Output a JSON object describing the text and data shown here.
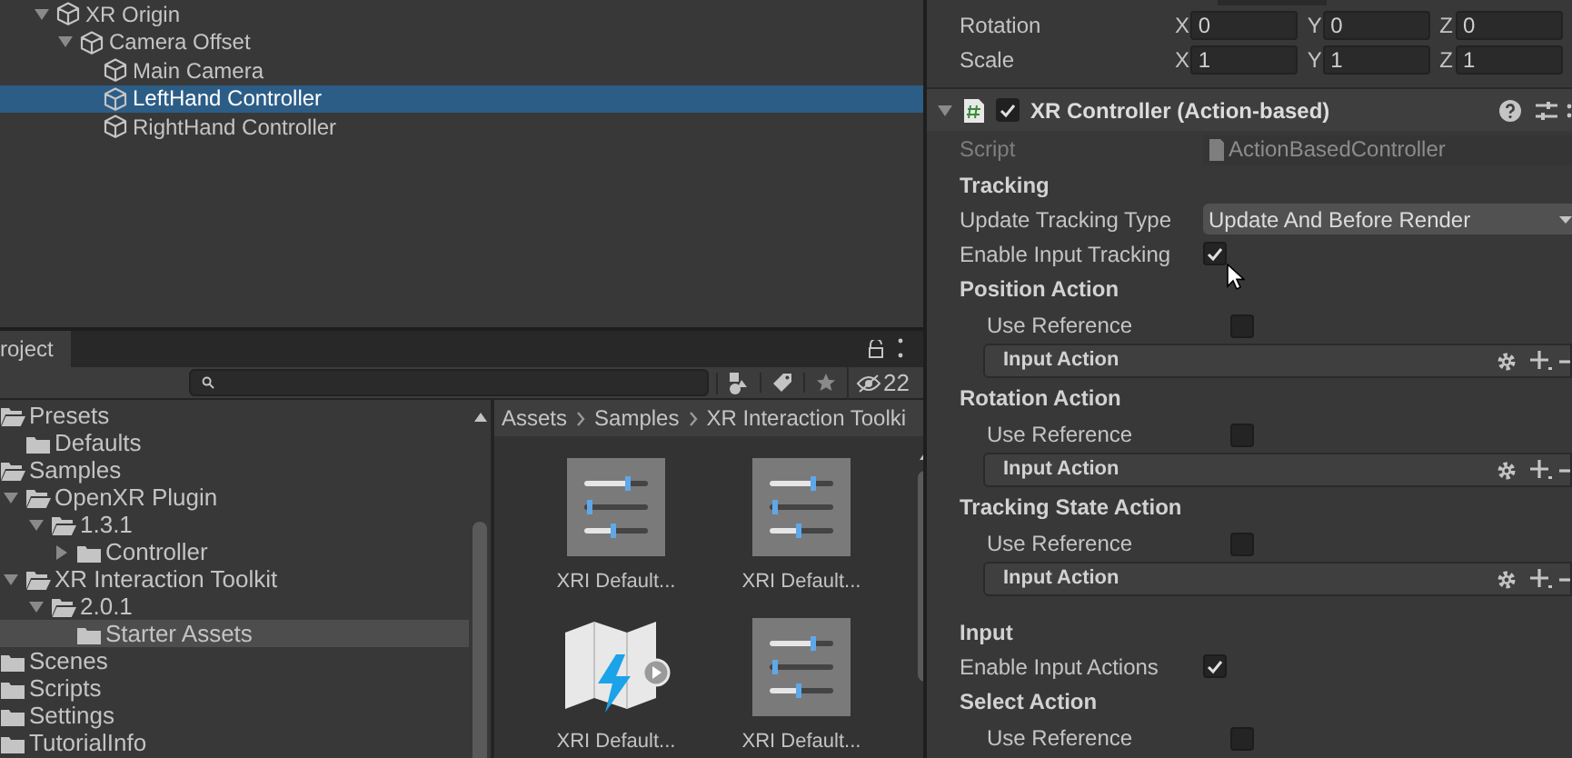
{
  "hierarchy": {
    "items": [
      {
        "label": "XR Origin",
        "expanded": true,
        "selected": false,
        "children": [
          {
            "label": "Camera Offset",
            "expanded": true,
            "selected": false,
            "children": [
              {
                "label": "Main Camera",
                "selected": false
              },
              {
                "label": "LeftHand Controller",
                "selected": true
              },
              {
                "label": "RightHand Controller",
                "selected": false
              }
            ]
          }
        ]
      }
    ]
  },
  "project": {
    "tab": "roject",
    "hidden_count": "22",
    "folders": [
      {
        "label": "Presets",
        "selected": false,
        "children": [
          {
            "label": "Defaults",
            "selected": false
          }
        ]
      },
      {
        "label": "Samples",
        "selected": false,
        "children": [
          {
            "label": "OpenXR Plugin",
            "expanded": true,
            "selected": false,
            "children": [
              {
                "label": "1.3.1",
                "expanded": true,
                "selected": false,
                "children": [
                  {
                    "label": "Controller",
                    "expanded": false,
                    "selected": false
                  }
                ]
              }
            ]
          },
          {
            "label": "XR Interaction Toolkit",
            "expanded": true,
            "selected": false,
            "children": [
              {
                "label": "2.0.1",
                "expanded": true,
                "selected": false,
                "children": [
                  {
                    "label": "Starter Assets",
                    "selected": true
                  }
                ]
              }
            ]
          }
        ]
      },
      {
        "label": "Scenes",
        "selected": false
      },
      {
        "label": "Scripts",
        "selected": false
      },
      {
        "label": "Settings",
        "selected": false
      },
      {
        "label": "TutorialInfo",
        "selected": false
      }
    ],
    "breadcrumb": [
      "Assets",
      "Samples",
      "XR Interaction Toolki"
    ],
    "assets": [
      {
        "kind": "preset",
        "label": "XRI Default..."
      },
      {
        "kind": "preset",
        "label": "XRI Default..."
      },
      {
        "kind": "action-map",
        "label": "XRI Default..."
      },
      {
        "kind": "preset",
        "label": "XRI Default..."
      }
    ]
  },
  "inspector": {
    "transform": [
      {
        "label": "Rotation",
        "values": [
          {
            "axis": "X",
            "value": "0"
          },
          {
            "axis": "Y",
            "value": "0"
          },
          {
            "axis": "Z",
            "value": "0"
          }
        ]
      },
      {
        "label": "Scale",
        "values": [
          {
            "axis": "X",
            "value": "1"
          },
          {
            "axis": "Y",
            "value": "1"
          },
          {
            "axis": "Z",
            "value": "1"
          }
        ]
      }
    ],
    "component": {
      "title": "XR Controller (Action-based)",
      "enabled": true,
      "expanded": true
    },
    "rows": [
      {
        "kind": "object",
        "label": "Script",
        "value": "ActionBasedController"
      },
      {
        "kind": "section",
        "label": "Tracking"
      },
      {
        "kind": "dropdown",
        "label": "Update Tracking Type",
        "value": "Update And Before Render"
      },
      {
        "kind": "checkbox",
        "label": "Enable Input Tracking",
        "checked": true
      },
      {
        "kind": "group",
        "label": "Position Action"
      },
      {
        "kind": "sub-checkbox",
        "label": "Use Reference",
        "checked": false
      },
      {
        "kind": "action",
        "label": "Input Action"
      },
      {
        "kind": "group",
        "label": "Rotation Action"
      },
      {
        "kind": "sub-checkbox",
        "label": "Use Reference",
        "checked": false
      },
      {
        "kind": "action",
        "label": "Input Action"
      },
      {
        "kind": "group",
        "label": "Tracking State Action"
      },
      {
        "kind": "sub-checkbox",
        "label": "Use Reference",
        "checked": false
      },
      {
        "kind": "action",
        "label": "Input Action"
      },
      {
        "kind": "section",
        "label": "Input"
      },
      {
        "kind": "checkbox",
        "label": "Enable Input Actions",
        "checked": true
      },
      {
        "kind": "group",
        "label": "Select Action"
      },
      {
        "kind": "sub-checkbox",
        "label": "Use Reference",
        "checked": false
      }
    ]
  }
}
